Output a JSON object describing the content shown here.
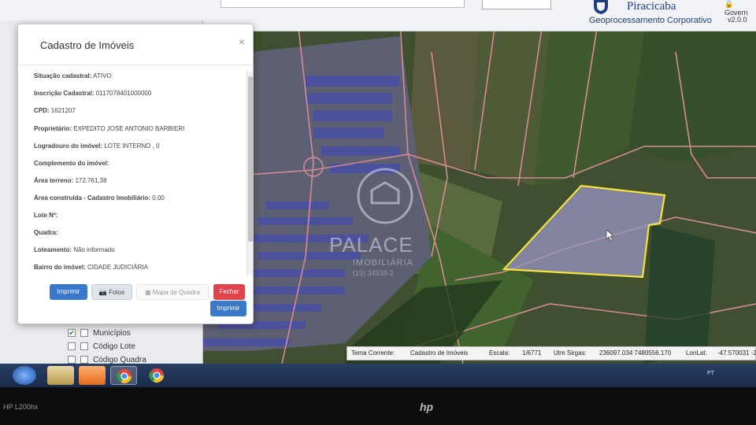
{
  "header": {
    "city": "Piracicaba",
    "department": "Geoprocessamento Corporativo",
    "user": "Govern",
    "version": "v2.0.0"
  },
  "modal": {
    "title": "Cadastro de Imóveis",
    "close": "×",
    "fields": [
      {
        "label": "Situação cadastral:",
        "value": "ATIVO"
      },
      {
        "label": "Inscrição Cadastral:",
        "value": "0117078401000000"
      },
      {
        "label": "CPD:",
        "value": "1621207"
      },
      {
        "label": "Proprietário:",
        "value": "EXPEDITO JOSE ANTONIO BARBIERI"
      },
      {
        "label": "Logradouro do imóvel:",
        "value": "LOTE INTERNO , 0"
      },
      {
        "label": "Complemento do imóvel:",
        "value": ""
      },
      {
        "label": "Área terreno:",
        "value": "172.761,38"
      },
      {
        "label": "Área construída - Cadastro Imobiliário:",
        "value": "0,00"
      },
      {
        "label": "Lote Nº:",
        "value": ""
      },
      {
        "label": "Quadra:",
        "value": ""
      },
      {
        "label": "Loteamento:",
        "value": "Não informado"
      },
      {
        "label": "Bairro do imóvel:",
        "value": "CIDADE JUDICIÁRIA"
      }
    ],
    "buttons": {
      "print": "Imprimir",
      "photos": "Fotos",
      "block_map": "Mapa de Quadra",
      "close": "Fechar",
      "print2": "Imprimir"
    }
  },
  "layers": [
    {
      "label": "Municípios",
      "checked": true
    },
    {
      "label": "Código Lote",
      "checked": false
    },
    {
      "label": "Código Quadra",
      "checked": false
    }
  ],
  "statusbar": {
    "theme_label": "Tema Corrente:",
    "theme_value": "Cadastro de Imóveis",
    "scale_label": "Escala:",
    "scale_value": "1/6771",
    "utm_label": "Utm Sirgas:",
    "utm_value": "236097.034 7480556.170",
    "lonlat_label": "LonLat:",
    "lonlat_value": "-47.570031 -2"
  },
  "watermark": {
    "name": "PALACE",
    "subtitle": "IMOBILIÁRIA",
    "phone": "(19) 34938-3"
  },
  "tray": {
    "lang": "PT"
  },
  "monitor": {
    "model": "HP L200hx",
    "brand": "hp"
  },
  "colors": {
    "parcel_outline": "#f5e23a",
    "lot_outline": "#d58a96",
    "print_button": "#3a78c9",
    "close_button": "#e0434a"
  }
}
